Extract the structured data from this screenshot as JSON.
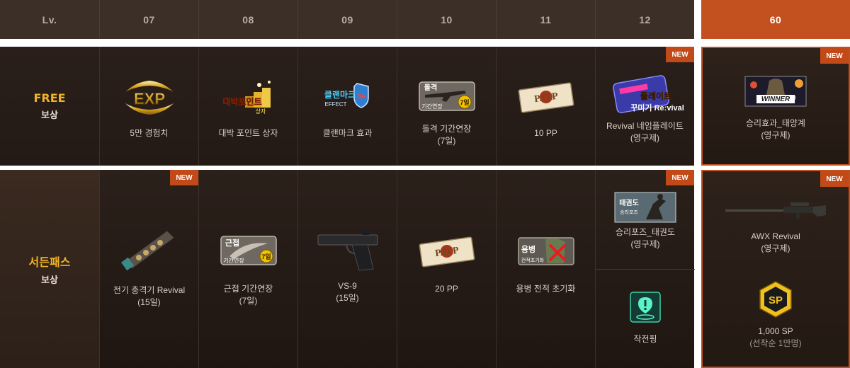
{
  "header": {
    "lv_label": "Lv.",
    "levels": [
      "07",
      "08",
      "09",
      "10",
      "11",
      "12"
    ],
    "lv60": "60"
  },
  "rows": {
    "free": {
      "title": "FREE",
      "sub": "보상"
    },
    "pass": {
      "title": "서든패스",
      "sub": "보상"
    }
  },
  "badge_text": "NEW",
  "free_items": [
    {
      "icon": "exp-badge-icon",
      "label": "5만 경험치",
      "sub": ""
    },
    {
      "icon": "point-box-icon",
      "label": "대박 포인트 상자",
      "sub": ""
    },
    {
      "icon": "clan-mark-effect-icon",
      "label": "클랜마크 효과",
      "sub": ""
    },
    {
      "icon": "assault-rifle-extend-icon",
      "label": "돌격 기간연장",
      "sub": "(7일)"
    },
    {
      "icon": "pp-ticket-icon",
      "label": "10 PP",
      "sub": ""
    },
    {
      "icon": "nameplate-revival-icon",
      "label": "Revival 네임플레이트",
      "sub": "(영구제)"
    }
  ],
  "free_lv60": {
    "icon": "winner-effect-icon",
    "label": "승리효과_태양계",
    "sub": "(영구제)"
  },
  "pass_items": [
    {
      "icon": "electric-shock-gun-icon",
      "label": "전기 충격기 Revival",
      "sub": "(15일)"
    },
    {
      "icon": "melee-extend-icon",
      "label": "근접 기간연장",
      "sub": "(7일)"
    },
    {
      "icon": "pistol-icon",
      "label": "VS-9",
      "sub": "(15일)"
    },
    {
      "icon": "pp-ticket-icon",
      "label": "20 PP",
      "sub": ""
    },
    {
      "icon": "mercenary-reset-icon",
      "label": "용병 전적 초기화",
      "sub": ""
    }
  ],
  "pass_col12": [
    {
      "icon": "victory-pose-icon",
      "label": "승리포즈_태권도",
      "sub": "(영구제)"
    },
    {
      "icon": "ping-icon",
      "label": "작전핑",
      "sub": ""
    }
  ],
  "pass_lv60": [
    {
      "icon": "sniper-rifle-icon",
      "label": "AWX Revival",
      "sub": "(영구제)"
    },
    {
      "icon": "sp-coin-icon",
      "label": "1,000 SP",
      "sub": "(선착순 1만명)"
    }
  ],
  "badge_labels": {
    "exp": "EXP",
    "winner": "WINNER",
    "pp": "P.O.P",
    "sp": "SP",
    "clan": "클랜마크",
    "clan_effect": "EFFECT",
    "assault": "돌격",
    "assault_sub": "기간연장",
    "days7": "7일",
    "melee": "근접",
    "melee_sub": "기간연장",
    "merc": "용병",
    "merc_sub": "전적초기화",
    "point": "대박포인트",
    "point_sub": "상자",
    "plate": "플레이트",
    "plate_sub": "꾸미기 Re:vival",
    "pose": "태권도",
    "pose_sub": "승리포즈"
  }
}
